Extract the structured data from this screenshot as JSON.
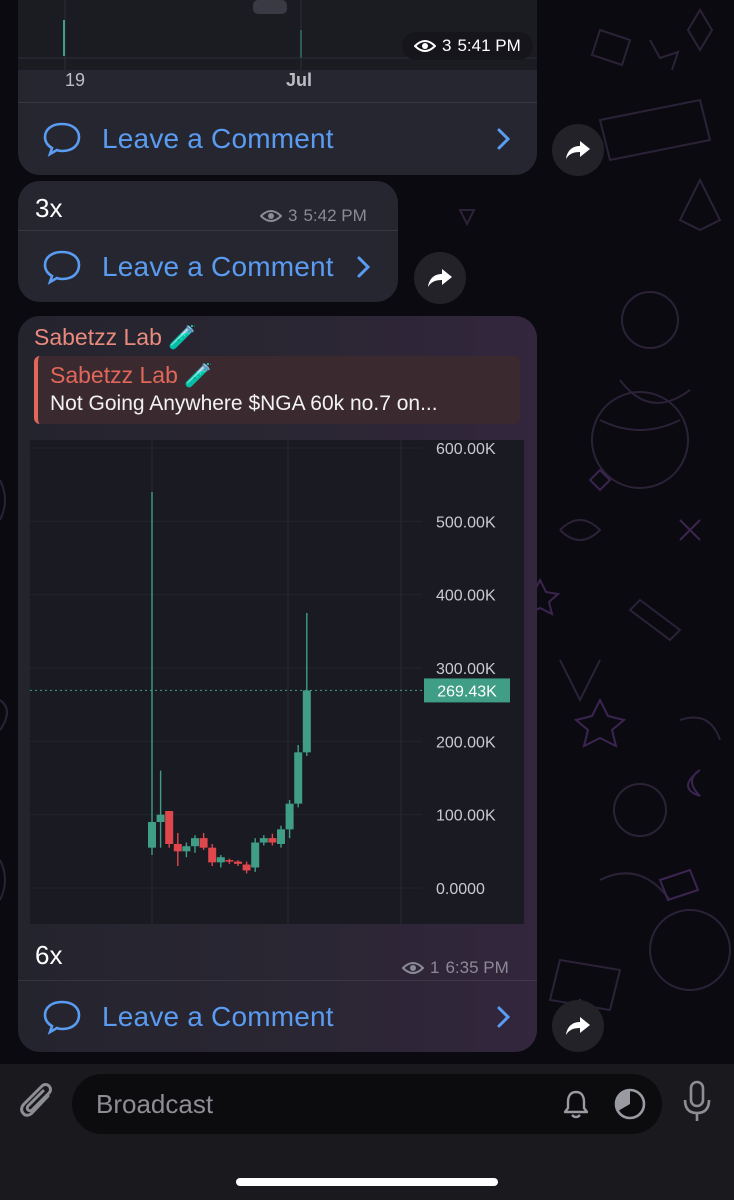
{
  "messages": [
    {
      "chart_tick": "19",
      "chart_tick_month": "Jul",
      "views": "3",
      "time": "5:41 PM",
      "comment_label": "Leave a Comment"
    },
    {
      "text": "3x",
      "views": "3",
      "time": "5:42 PM",
      "comment_label": "Leave a Comment"
    },
    {
      "author": "Sabetzz Lab 🧪",
      "reply": {
        "author": "Sabetzz Lab 🧪",
        "text": "Not Going Anywhere $NGA 60k no.7 on..."
      },
      "text": "6x",
      "views": "1",
      "time": "6:35 PM",
      "comment_label": "Leave a Comment"
    }
  ],
  "chart_data": {
    "type": "candlestick",
    "y_ticks": [
      "600.00K",
      "500.00K",
      "400.00K",
      "300.00K",
      "200.00K",
      "100.00K",
      "0.0000"
    ],
    "ylim": [
      0,
      600000
    ],
    "current_price_label": "269.43K",
    "current_price": 269430,
    "candles": [
      {
        "o": 55000,
        "h": 540000,
        "l": 45000,
        "c": 90000
      },
      {
        "o": 90000,
        "h": 160000,
        "l": 55000,
        "c": 100000
      },
      {
        "o": 105000,
        "h": 105000,
        "l": 55000,
        "c": 60000
      },
      {
        "o": 60000,
        "h": 75000,
        "l": 30000,
        "c": 50000
      },
      {
        "o": 50000,
        "h": 62000,
        "l": 42000,
        "c": 57000
      },
      {
        "o": 57000,
        "h": 72000,
        "l": 48000,
        "c": 68000
      },
      {
        "o": 68000,
        "h": 75000,
        "l": 52000,
        "c": 55000
      },
      {
        "o": 55000,
        "h": 60000,
        "l": 30000,
        "c": 35000
      },
      {
        "o": 35000,
        "h": 45000,
        "l": 28000,
        "c": 42000
      },
      {
        "o": 38000,
        "h": 40000,
        "l": 33000,
        "c": 36000
      },
      {
        "o": 36000,
        "h": 38000,
        "l": 30000,
        "c": 33000
      },
      {
        "o": 32000,
        "h": 36000,
        "l": 20000,
        "c": 24000
      },
      {
        "o": 28000,
        "h": 68000,
        "l": 22000,
        "c": 62000
      },
      {
        "o": 62000,
        "h": 72000,
        "l": 58000,
        "c": 68000
      },
      {
        "o": 68000,
        "h": 74000,
        "l": 58000,
        "c": 62000
      },
      {
        "o": 60000,
        "h": 85000,
        "l": 55000,
        "c": 80000
      },
      {
        "o": 80000,
        "h": 120000,
        "l": 68000,
        "c": 115000
      },
      {
        "o": 115000,
        "h": 195000,
        "l": 110000,
        "c": 185000
      },
      {
        "o": 185000,
        "h": 375000,
        "l": 180000,
        "c": 269430
      }
    ],
    "up_color": "#3f9e85",
    "down_color": "#e0474c"
  },
  "input": {
    "placeholder": "Broadcast"
  },
  "colors": {
    "accent": "#5a9cf2",
    "author": "#e98a7d",
    "price_badge": "#3f9e85"
  }
}
